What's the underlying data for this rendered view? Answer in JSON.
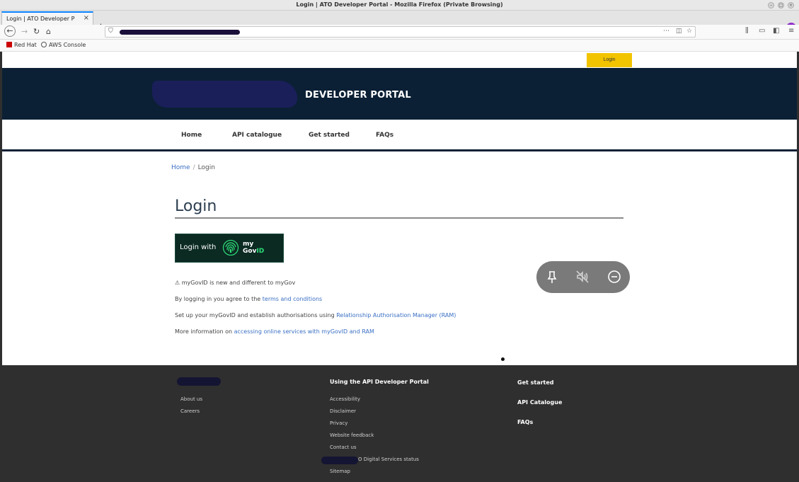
{
  "window": {
    "title": "Login | ATO Developer Portal - Mozilla Firefox (Private Browsing)"
  },
  "browser": {
    "tab_title": "Login | ATO Developer P",
    "tab_close": "×",
    "new_tab": "+",
    "ext_badge": "∞",
    "bookmarks": [
      {
        "label": "Red Hat",
        "color": "#cc0000"
      },
      {
        "label": "AWS Console",
        "color": "#555555"
      }
    ]
  },
  "site": {
    "utility_login": "Login",
    "portal_title": "DEVELOPER PORTAL",
    "nav": [
      "Home",
      "API catalogue",
      "Get started",
      "FAQs"
    ]
  },
  "breadcrumb": {
    "home": "Home",
    "sep": "/",
    "current": "Login"
  },
  "main": {
    "heading": "Login",
    "mygov_button": {
      "prefix": "Login with",
      "brand_top": "my",
      "brand_gov": "Gov",
      "brand_id": "ID"
    },
    "notice": "⚠ myGovID is new and different to myGov",
    "terms_prefix": "By logging in you agree to the ",
    "terms_link": "terms and conditions",
    "ram_prefix": "Set up your myGovID and establish authorisations using ",
    "ram_link": "Relationship Authorisation Manager (RAM)",
    "more_prefix": "More information on ",
    "more_link": "accessing online services with myGovID and RAM"
  },
  "footer": {
    "col1": [
      "About us",
      "Careers"
    ],
    "col2_title": "Using the API Developer Portal",
    "col2": [
      "Accessibility",
      "Disclaimer",
      "Privacy",
      "Website feedback",
      "Contact us",
      "O Digital Services status",
      "Sitemap"
    ],
    "col3": [
      "Get started",
      "API Catalogue",
      "FAQs"
    ]
  },
  "colors": {
    "brand_navy": "#0b2035",
    "login_yellow": "#f2c400",
    "link_blue": "#3a6fc4",
    "footer_bg": "#2f2f2f"
  },
  "icons": [
    "back-arrow-icon",
    "forward-arrow-icon",
    "reload-icon",
    "home-icon",
    "pin-icon",
    "mute-icon",
    "minus-circle-icon",
    "fingerprint-icon"
  ]
}
